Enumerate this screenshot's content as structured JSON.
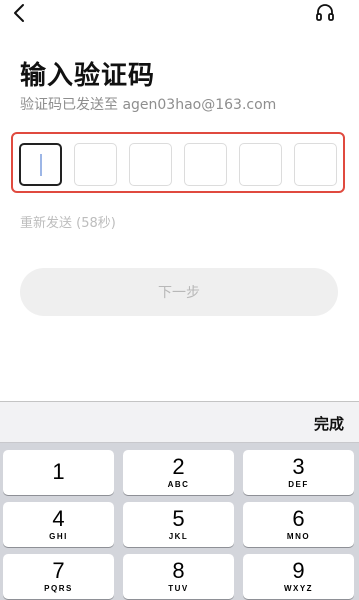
{
  "header": {
    "back_icon": "chevron-left-icon",
    "support_icon": "headset-icon"
  },
  "page": {
    "title": "输入验证码",
    "subtitle": "验证码已发送至 agen03hao@163.com",
    "code_length": 6,
    "code_values": [
      "",
      "",
      "",
      "",
      "",
      ""
    ],
    "resend_text": "重新发送 (58秒)",
    "next_label": "下一步"
  },
  "keyboard": {
    "done_label": "完成",
    "keys": [
      {
        "num": "1",
        "letters": ""
      },
      {
        "num": "2",
        "letters": "ABC"
      },
      {
        "num": "3",
        "letters": "DEF"
      },
      {
        "num": "4",
        "letters": "GHI"
      },
      {
        "num": "5",
        "letters": "JKL"
      },
      {
        "num": "6",
        "letters": "MNO"
      },
      {
        "num": "7",
        "letters": "PQRS"
      },
      {
        "num": "8",
        "letters": "TUV"
      },
      {
        "num": "9",
        "letters": "WXYZ"
      }
    ]
  },
  "colors": {
    "highlight_border": "#e04a3f",
    "disabled_button": "#efefef",
    "keyboard_bg": "#d3d5db"
  }
}
